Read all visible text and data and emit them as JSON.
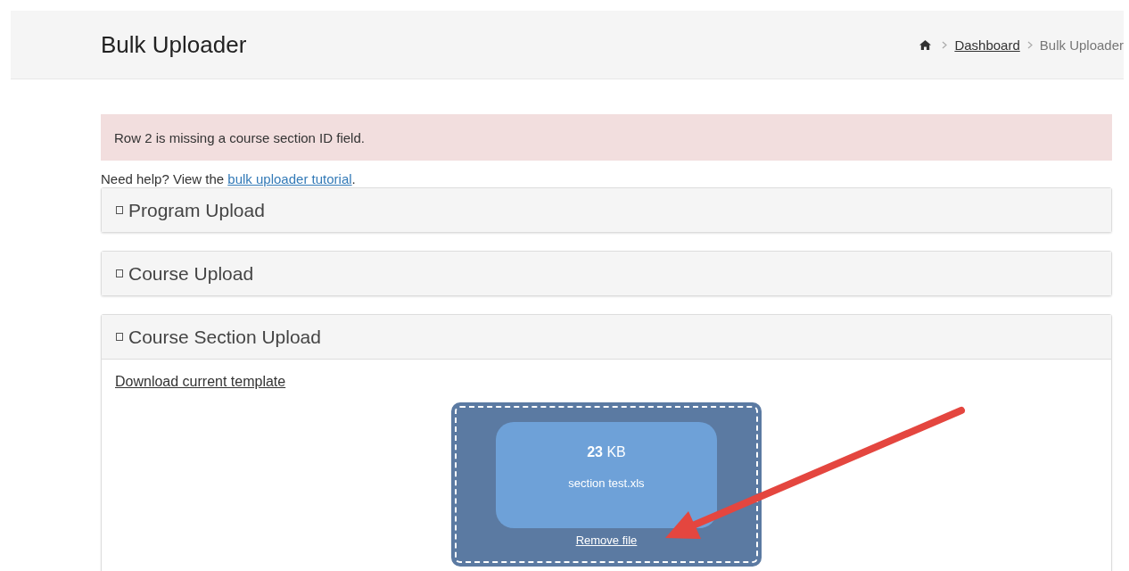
{
  "header": {
    "title": "Bulk Uploader",
    "breadcrumb": [
      {
        "kind": "home"
      },
      {
        "kind": "link",
        "label": "Dashboard"
      },
      {
        "kind": "current",
        "label": "Bulk Uploader"
      }
    ]
  },
  "alert": {
    "text": "Row 2 is missing a course section ID field."
  },
  "help": {
    "before": "Need help? View the ",
    "link": "bulk uploader tutorial",
    "after": "."
  },
  "panels": [
    {
      "title": "Program Upload",
      "expanded": false
    },
    {
      "title": "Course Upload",
      "expanded": false
    },
    {
      "title": "Course Section Upload",
      "expanded": true,
      "template_link": "Download current template",
      "file": {
        "size": "**23** KB",
        "name": "section test.xls",
        "remove": "Remove file"
      }
    }
  ]
}
